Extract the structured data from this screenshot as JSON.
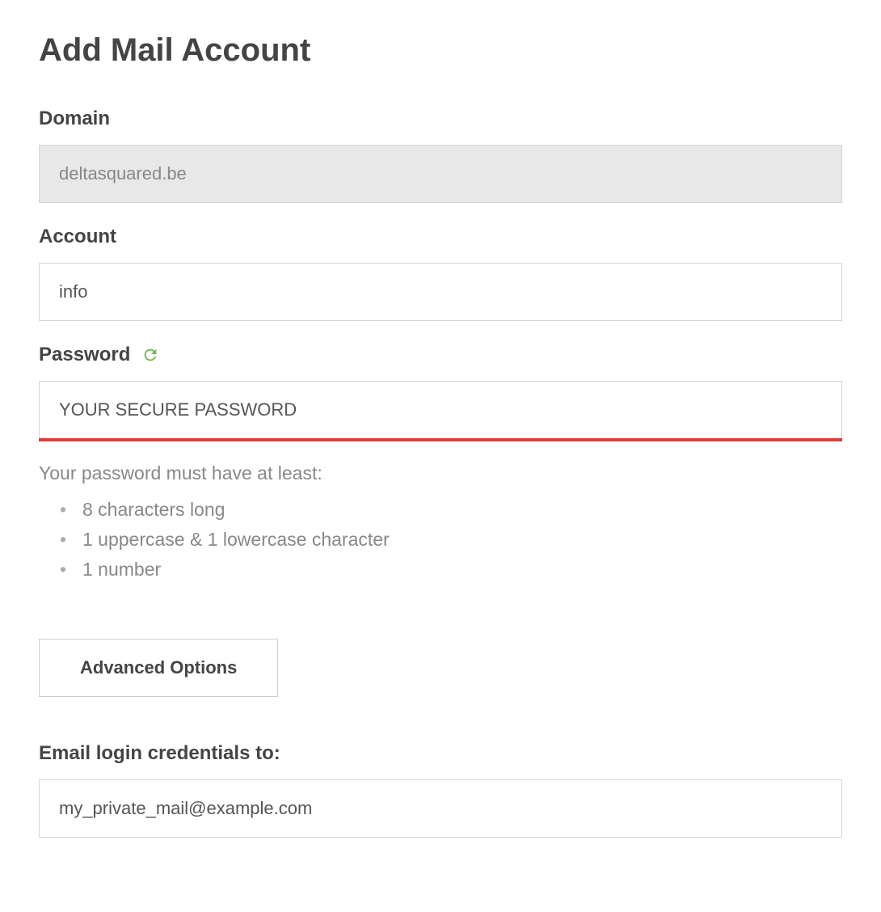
{
  "page": {
    "title": "Add Mail Account"
  },
  "form": {
    "domain": {
      "label": "Domain",
      "value": "deltasquared.be"
    },
    "account": {
      "label": "Account",
      "value": "info"
    },
    "password": {
      "label": "Password",
      "value": "YOUR SECURE PASSWORD",
      "helper_intro": "Your password must have at least:",
      "requirements": [
        "8 characters long",
        "1 uppercase & 1 lowercase character",
        "1 number"
      ],
      "strength_color": "#e53935"
    },
    "advanced_button": "Advanced Options",
    "email_credentials": {
      "label": "Email login credentials to:",
      "value": "my_private_mail@example.com"
    }
  }
}
